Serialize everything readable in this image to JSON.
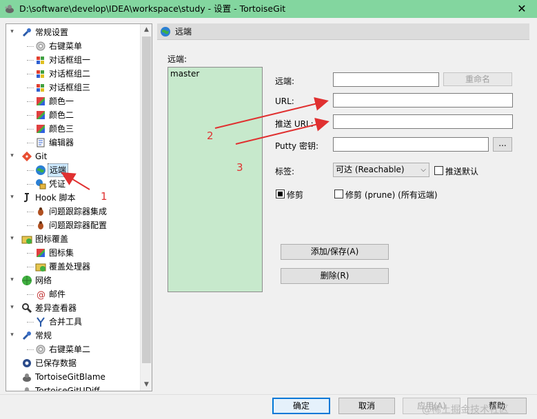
{
  "window": {
    "title": "D:\\software\\develop\\IDEA\\workspace\\study - 设置 - TortoiseGit",
    "close_glyph": "✕"
  },
  "tree": {
    "items": [
      {
        "label": "常规设置",
        "level": 0,
        "expander": "⊟",
        "icon": "wrench-icon"
      },
      {
        "label": "右键菜单",
        "level": 1,
        "icon": "gear-icon"
      },
      {
        "label": "对话框组一",
        "level": 1,
        "icon": "windows-icon"
      },
      {
        "label": "对话框组二",
        "level": 1,
        "icon": "windows-icon"
      },
      {
        "label": "对话框组三",
        "level": 1,
        "icon": "windows-icon"
      },
      {
        "label": "颜色一",
        "level": 1,
        "icon": "palette-icon"
      },
      {
        "label": "颜色二",
        "level": 1,
        "icon": "palette-icon"
      },
      {
        "label": "颜色三",
        "level": 1,
        "icon": "palette-icon"
      },
      {
        "label": "编辑器",
        "level": 1,
        "icon": "editor-icon"
      },
      {
        "label": "Git",
        "level": 0,
        "expander": "⊟",
        "icon": "git-icon"
      },
      {
        "label": "远端",
        "level": 1,
        "icon": "globe-icon",
        "selected": true
      },
      {
        "label": "凭证",
        "level": 1,
        "icon": "credential-icon"
      },
      {
        "label": "Hook 脚本",
        "level": 0,
        "expander": "⊟",
        "icon": "hook-icon"
      },
      {
        "label": "问题跟踪器集成",
        "level": 1,
        "icon": "bug-icon"
      },
      {
        "label": "问题跟踪器配置",
        "level": 1,
        "icon": "bug-icon"
      },
      {
        "label": "图标覆盖",
        "level": 0,
        "expander": "⊟",
        "icon": "overlay-icon"
      },
      {
        "label": "图标集",
        "level": 1,
        "icon": "palette-icon"
      },
      {
        "label": "覆盖处理器",
        "level": 1,
        "icon": "overlay-icon"
      },
      {
        "label": "网络",
        "level": 0,
        "expander": "⊟",
        "icon": "network-icon"
      },
      {
        "label": "邮件",
        "level": 1,
        "icon": "at-icon"
      },
      {
        "label": "差异查看器",
        "level": 0,
        "expander": "⊟",
        "icon": "magnifier-icon"
      },
      {
        "label": "合并工具",
        "level": 1,
        "icon": "merge-icon"
      },
      {
        "label": "常规",
        "level": 0,
        "expander": "⊟",
        "icon": "wrench-icon"
      },
      {
        "label": "右键菜单二",
        "level": 1,
        "icon": "gear-icon"
      },
      {
        "label": "已保存数据",
        "level": 0,
        "icon": "saved-data-icon"
      },
      {
        "label": "TortoiseGitBlame",
        "level": 0,
        "icon": "blame-icon"
      },
      {
        "label": "TortoiseGitUDiff",
        "level": 0,
        "icon": "udiff-icon"
      }
    ]
  },
  "panel": {
    "header": "远端",
    "remote_list_label": "远端:",
    "remote_list_items": [
      "master"
    ],
    "fields": {
      "remote_label": "远端:",
      "remote_value": "",
      "rename_button": "重命名",
      "url_label": "URL:",
      "url_value": "",
      "push_url_label": "推送 URL:",
      "push_url_value": "",
      "putty_key_label": "Putty 密钥:",
      "putty_key_value": "",
      "browse_button": "...",
      "tag_label": "标签:",
      "tag_select_value": "可达 (Reachable)",
      "push_default_label": "推送默认",
      "prune_label": "修剪",
      "prune_all_label": "修剪 (prune) (所有远端)"
    },
    "add_save_button": "添加/保存(A)",
    "delete_button": "删除(R)"
  },
  "annotations": {
    "one": "1",
    "two": "2",
    "three": "3"
  },
  "dialog_buttons": {
    "ok": "确定",
    "cancel": "取消",
    "apply": "应用(A)",
    "help": "帮助"
  },
  "watermark": "@稀土掘金技术社区",
  "colors": {
    "titlebar": "#83d69f",
    "remote_list_bg": "#c7e9cc",
    "selection": "#cce8ff",
    "annotation": "#e03030"
  }
}
